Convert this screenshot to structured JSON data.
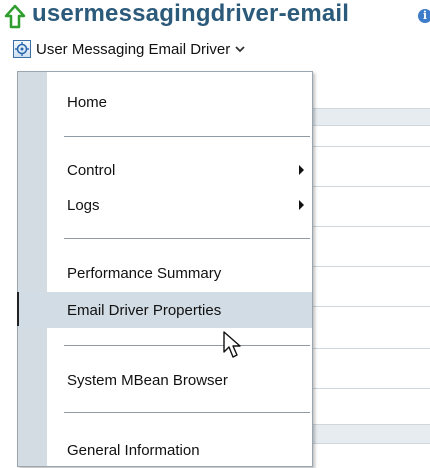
{
  "header": {
    "title": "usermessagingdriver-email",
    "info_glyph": "i",
    "target_label": "User Messaging Email Driver"
  },
  "menu": {
    "items": [
      {
        "label": "Home"
      },
      {
        "label": "Control"
      },
      {
        "label": "Logs"
      },
      {
        "label": "Performance Summary"
      },
      {
        "label": "Email Driver Properties"
      },
      {
        "label": "System MBean Browser"
      },
      {
        "label": "General Information"
      }
    ],
    "selected": "Email Driver Properties"
  },
  "icons": [
    "up-arrow-icon",
    "info-icon",
    "target-icon",
    "chevron-down-icon",
    "submenu-arrow-icon",
    "mouse-cursor-icon"
  ],
  "colors": {
    "title": "#2c5a7a",
    "up_arrow": "#2f9e2f",
    "menu_gutter": "#d3dce3",
    "selected_bg": "#d2dce4"
  }
}
